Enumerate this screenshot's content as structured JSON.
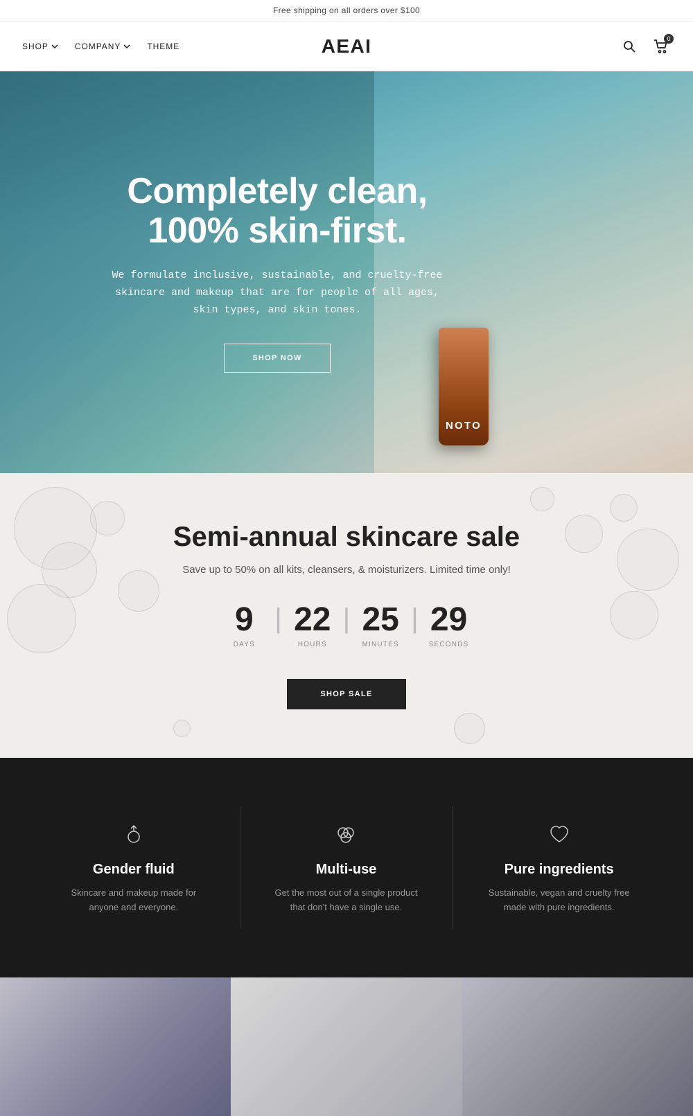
{
  "announcement": {
    "text": "Free shipping on all orders over $100"
  },
  "header": {
    "nav": [
      {
        "label": "SHOP",
        "has_dropdown": true
      },
      {
        "label": "COMPANY",
        "has_dropdown": true
      },
      {
        "label": "THEME",
        "has_dropdown": false
      }
    ],
    "logo": "AEAI",
    "cart_count": "0"
  },
  "hero": {
    "title": "Completely clean, 100% skin-first.",
    "description": "We formulate inclusive, sustainable, and cruelty-free skincare and makeup that are for people of all ages, skin types, and skin tones.",
    "cta_label": "SHOP NOW",
    "product_name": "NOTO"
  },
  "sale": {
    "title": "Semi-annual skincare sale",
    "description": "Save up to 50% on all kits, cleansers, & moisturizers. Limited time only!",
    "countdown": {
      "days": "9",
      "hours": "22",
      "minutes": "25",
      "seconds": "29",
      "days_label": "DAYS",
      "hours_label": "HOURS",
      "minutes_label": "MINUTES",
      "seconds_label": "SECONDS"
    },
    "cta_label": "SHOP SALE"
  },
  "features": [
    {
      "icon": "ring-icon",
      "title": "Gender fluid",
      "description": "Skincare and makeup made for anyone and everyone."
    },
    {
      "icon": "circles-icon",
      "title": "Multi-use",
      "description": "Get the most out of a single product that don't have a single use."
    },
    {
      "icon": "heart-icon",
      "title": "Pure ingredients",
      "description": "Sustainable, vegan and cruelty free made with pure ingredients."
    }
  ]
}
